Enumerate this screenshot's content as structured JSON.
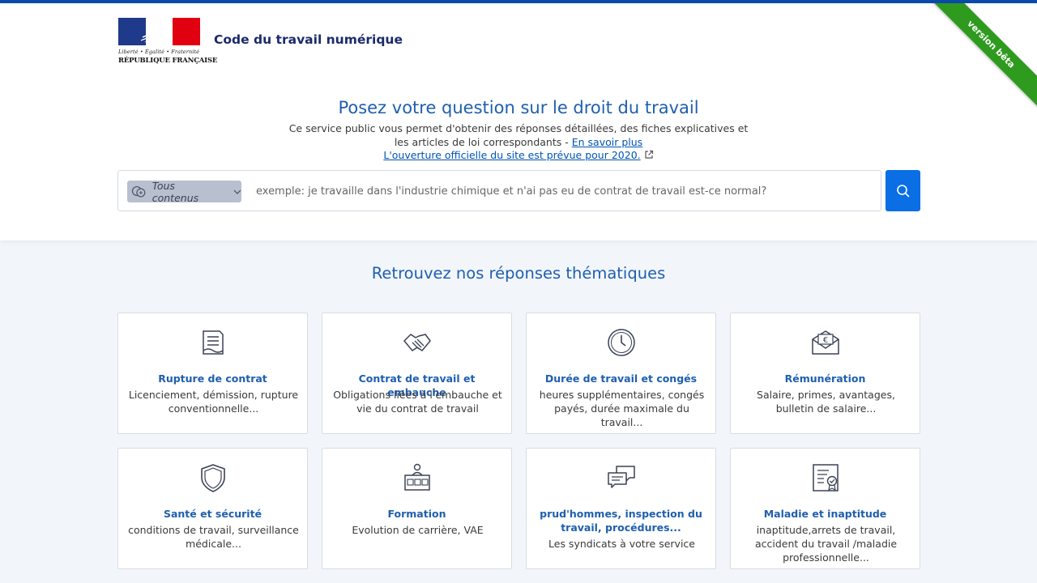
{
  "header": {
    "logo_devise": "Liberté • Égalité • Fraternité",
    "logo_republique": "RÉPUBLIQUE FRANÇAISE",
    "site_title": "Code du travail numérique",
    "beta_ribbon": "version bêta"
  },
  "hero": {
    "title": "Posez votre question sur le droit du travail",
    "desc_line1": "Ce service public vous permet d'obtenir des réponses détaillées, des fiches explicatives et",
    "desc_line2": "les articles de loi correspondants - ",
    "learn_more": "En savoir plus",
    "launch_link": "L'ouverture officielle du site est prévue pour 2020."
  },
  "search": {
    "filter_label": "Tous contenus",
    "placeholder": "exemple: je travaille dans l'industrie chimique et n'ai pas eu de contrat de travail est-ce normal?",
    "button_icon": "search-icon"
  },
  "themes": {
    "title": "Retrouvez nos réponses thématiques",
    "cards": [
      {
        "title": "Rupture de contrat",
        "desc": "Licenciement, démission, rupture conventionnelle...",
        "icon": "document-icon"
      },
      {
        "title": "Contrat de travail et embauche",
        "desc": "Obligations liées à l'embauche et vie du contrat de travail",
        "icon": "handshake-icon"
      },
      {
        "title": "Durée de travail et congés",
        "desc": "heures supplémentaires, congés payés, durée maximale du travail...",
        "icon": "clock-icon"
      },
      {
        "title": "Rémunération",
        "desc": "Salaire, primes, avantages, bulletin de salaire...",
        "icon": "euro-envelope-icon"
      },
      {
        "title": "Santé et sécurité",
        "desc": "conditions de travail, surveillance médicale...",
        "icon": "shield-icon"
      },
      {
        "title": "Formation",
        "desc": "Evolution de carrière, VAE",
        "icon": "training-icon"
      },
      {
        "title": "prud'hommes, inspection du travail, procédures...",
        "desc": "Les syndicats à votre service",
        "icon": "chat-bubbles-icon"
      },
      {
        "title": "Maladie et inaptitude",
        "desc": "inaptitude,arrets de travail, accident du travail /maladie professionnelle...",
        "icon": "certificate-icon"
      }
    ]
  }
}
